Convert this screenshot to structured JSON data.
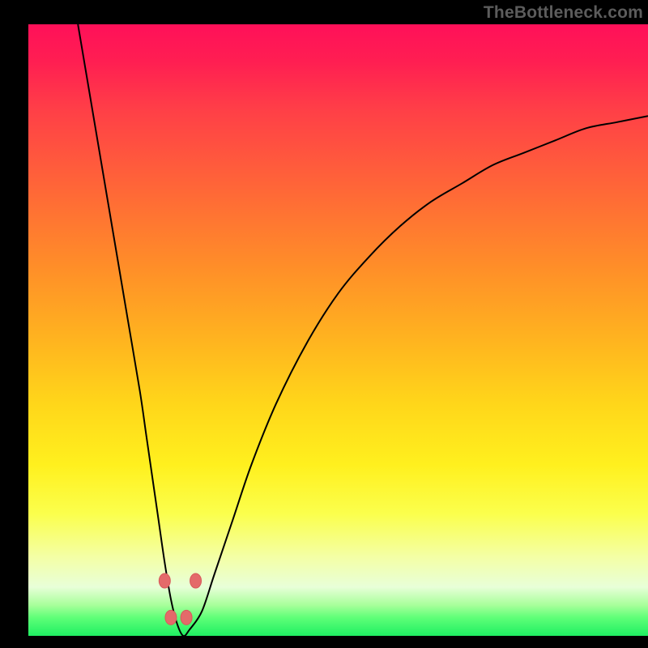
{
  "watermark": "TheBottleneck.com",
  "chart_data": {
    "type": "line",
    "title": "",
    "xlabel": "",
    "ylabel": "",
    "xlim": [
      0,
      100
    ],
    "ylim": [
      0,
      100
    ],
    "grid": false,
    "legend": false,
    "series": [
      {
        "name": "bottleneck-curve",
        "color": "#000000",
        "x": [
          8,
          10,
          12,
          14,
          16,
          18,
          19,
          20,
          21,
          22,
          23,
          24,
          25,
          26,
          28,
          30,
          33,
          36,
          40,
          45,
          50,
          55,
          60,
          65,
          70,
          75,
          80,
          85,
          90,
          95,
          100
        ],
        "y": [
          100,
          88,
          76,
          64,
          52,
          40,
          33,
          26,
          19,
          12,
          6,
          2,
          0,
          1,
          4,
          10,
          19,
          28,
          38,
          48,
          56,
          62,
          67,
          71,
          74,
          77,
          79,
          81,
          83,
          84,
          85
        ]
      }
    ],
    "markers": {
      "name": "highlight-points",
      "color": "#e46a6a",
      "points": [
        {
          "x": 22.0,
          "y": 9
        },
        {
          "x": 23.0,
          "y": 3
        },
        {
          "x": 25.5,
          "y": 3
        },
        {
          "x": 27.0,
          "y": 9
        }
      ]
    }
  },
  "colors": {
    "frame": "#000000",
    "curve": "#000000",
    "marker": "#e46a6a",
    "gradient_top": "#ff1059",
    "gradient_bottom": "#1fef62"
  }
}
